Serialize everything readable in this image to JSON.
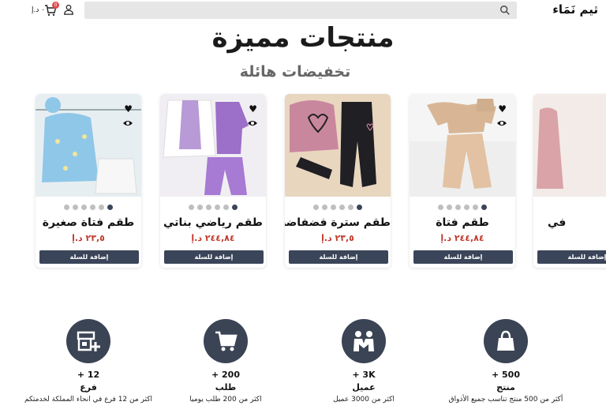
{
  "header": {
    "logo": "ثيم نَمَاء",
    "search": {
      "placeholder": ""
    },
    "cart": {
      "badge": "0",
      "total": "٠ د.إ"
    }
  },
  "section": {
    "title": "منتجات مميزة",
    "subtitle": "تخفيضات هائلة"
  },
  "products": [
    {
      "name": "في",
      "price": "",
      "button": "إضافة للسلة",
      "image": "pink-dress"
    },
    {
      "name": "طقم فتاة",
      "price": "٢٤٤,٨٤ د.إ",
      "button": "إضافة للسلة",
      "image": "beige-set"
    },
    {
      "name": "طقم سترة فضفاضة",
      "price": "٢٣,٥ د.إ",
      "button": "إضافة للسلة",
      "image": "pink-heart-sweater"
    },
    {
      "name": "طقم رياضي بناتي",
      "price": "٢٤٤,٨٤ د.إ",
      "button": "إضافة للسلة",
      "image": "lilac-tracksuit"
    },
    {
      "name": "طقم فتاة صغيرة",
      "price": "٢٣,٥ د.إ",
      "button": "إضافة للسلة",
      "image": "blue-cardigan"
    }
  ],
  "stats": [
    {
      "count": "500 +",
      "label": "منتج",
      "desc": "أكثر من 500 منتج تناسب جميع الأذواق",
      "icon": "shopping-bag-icon"
    },
    {
      "count": "3K +",
      "label": "عميل",
      "desc": "اكثر من 3000 عميل",
      "icon": "customers-icon"
    },
    {
      "count": "200 +",
      "label": "طلب",
      "desc": "اكثر من 200 طلب يوميا",
      "icon": "cart-icon"
    },
    {
      "count": "12 +",
      "label": "فرع",
      "desc": "اكثر من 12 فرع في انحاء المملكة لخدمتكم",
      "icon": "store-add-icon"
    }
  ],
  "colors": {
    "accent": "#3b4559",
    "price": "#c0392b",
    "badge": "#e24848"
  }
}
